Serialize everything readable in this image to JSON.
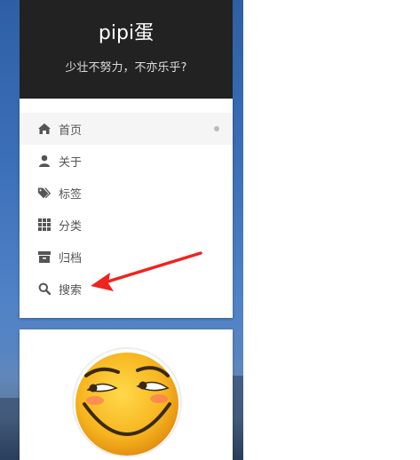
{
  "site": {
    "title": "pipi蛋",
    "subtitle": "少壮不努力，不亦乐乎?"
  },
  "menu": {
    "items": [
      {
        "label": "首页",
        "icon": "home-icon",
        "active": true
      },
      {
        "label": "关于",
        "icon": "user-icon"
      },
      {
        "label": "标签",
        "icon": "tags-icon"
      },
      {
        "label": "分类",
        "icon": "grid-icon"
      },
      {
        "label": "归档",
        "icon": "archive-icon"
      },
      {
        "label": "搜索",
        "icon": "search-icon"
      }
    ]
  },
  "colors": {
    "header_bg": "#222222",
    "annotation_arrow": "#f0231d",
    "icon": "#555555"
  }
}
